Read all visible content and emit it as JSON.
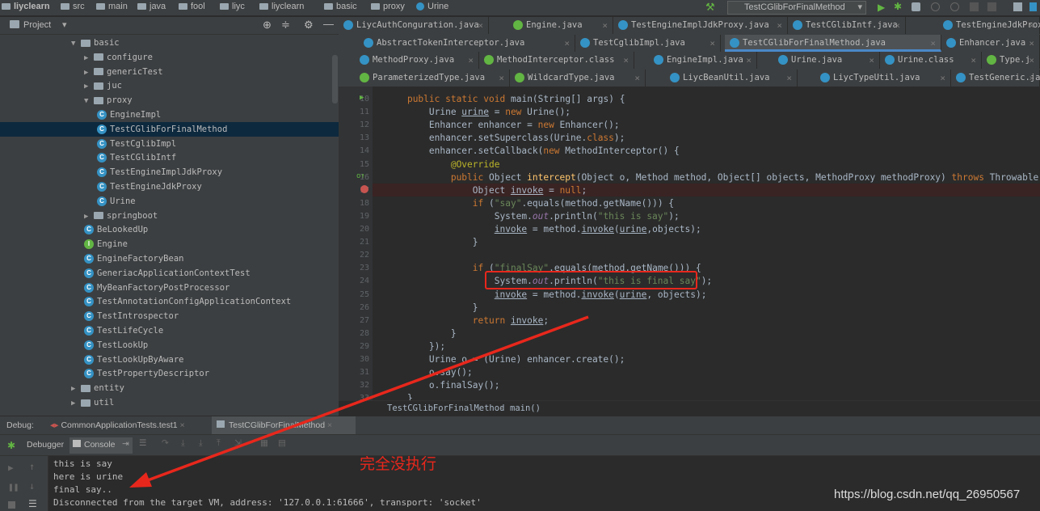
{
  "breadcrumb": [
    "liyclearn",
    "src",
    "main",
    "java",
    "fool",
    "liyc",
    "liyclearn",
    "basic",
    "proxy",
    "Urine"
  ],
  "run_config": "TestCGlibForFinalMethod",
  "project_panel": {
    "title": "Project"
  },
  "tree": [
    {
      "label": "basic",
      "kind": "folder",
      "open": true
    },
    {
      "label": "configure",
      "kind": "folder",
      "open": false
    },
    {
      "label": "genericTest",
      "kind": "folder",
      "open": false
    },
    {
      "label": "juc",
      "kind": "folder",
      "open": false
    },
    {
      "label": "proxy",
      "kind": "folder",
      "open": true
    },
    {
      "label": "EngineImpl",
      "kind": "class"
    },
    {
      "label": "TestCGlibForFinalMethod",
      "kind": "class",
      "selected": true
    },
    {
      "label": "TestCglibImpl",
      "kind": "class"
    },
    {
      "label": "TestCGlibIntf",
      "kind": "class"
    },
    {
      "label": "TestEngineImplJdkProxy",
      "kind": "class"
    },
    {
      "label": "TestEngineJdkProxy",
      "kind": "class"
    },
    {
      "label": "Urine",
      "kind": "class"
    },
    {
      "label": "springboot",
      "kind": "folder",
      "open": false
    },
    {
      "label": "BeLookedUp",
      "kind": "class"
    },
    {
      "label": "Engine",
      "kind": "interface"
    },
    {
      "label": "EngineFactoryBean",
      "kind": "class"
    },
    {
      "label": "GeneriacApplicationContextTest",
      "kind": "class"
    },
    {
      "label": "MyBeanFactoryPostProcessor",
      "kind": "class"
    },
    {
      "label": "TestAnnotationConfigApplicationContext",
      "kind": "class"
    },
    {
      "label": "TestIntrospector",
      "kind": "class"
    },
    {
      "label": "TestLifeCycle",
      "kind": "class"
    },
    {
      "label": "TestLookUp",
      "kind": "class"
    },
    {
      "label": "TestLookUpByAware",
      "kind": "class"
    },
    {
      "label": "TestPropertyDescriptor",
      "kind": "class"
    },
    {
      "label": "entity",
      "kind": "folder",
      "open": false
    },
    {
      "label": "util",
      "kind": "folder",
      "open": false
    }
  ],
  "tab_rows": [
    [
      {
        "label": "LiycAuthConguration.java",
        "icon": "class"
      },
      {
        "label": "Engine.java",
        "icon": "interface"
      },
      {
        "label": "TestEngineImplJdkProxy.java",
        "icon": "class"
      },
      {
        "label": "TestCGlibIntf.java",
        "icon": "class"
      },
      {
        "label": "TestEngineJdkProxy.j",
        "icon": "class"
      }
    ],
    [
      {
        "label": "AbstractTokenInterceptor.java",
        "icon": "class"
      },
      {
        "label": "TestCglibImpl.java",
        "icon": "class"
      },
      {
        "label": "TestCGlibForFinalMethod.java",
        "icon": "class",
        "active": true
      },
      {
        "label": "Enhancer.java",
        "icon": "class"
      }
    ],
    [
      {
        "label": "MethodProxy.java",
        "icon": "class"
      },
      {
        "label": "MethodInterceptor.class",
        "icon": "interface"
      },
      {
        "label": "EngineImpl.java",
        "icon": "class"
      },
      {
        "label": "Urine.java",
        "icon": "class"
      },
      {
        "label": "Urine.class",
        "icon": "class"
      },
      {
        "label": "Type.j",
        "icon": "interface"
      }
    ],
    [
      {
        "label": "ParameterizedType.java",
        "icon": "interface"
      },
      {
        "label": "WildcardType.java",
        "icon": "interface"
      },
      {
        "label": "LiycBeanUtil.java",
        "icon": "class"
      },
      {
        "label": "LiycTypeUtil.java",
        "icon": "class"
      },
      {
        "label": "TestGeneric.ja",
        "icon": "class"
      }
    ]
  ],
  "code_lines": [
    {
      "n": "10",
      "text": "    public static void main(String[] args) {"
    },
    {
      "n": "11",
      "text": "        Urine urine = new Urine();"
    },
    {
      "n": "12",
      "text": "        Enhancer enhancer = new Enhancer();"
    },
    {
      "n": "13",
      "text": "        enhancer.setSuperclass(Urine.class);"
    },
    {
      "n": "14",
      "text": "        enhancer.setCallback(new MethodInterceptor() {"
    },
    {
      "n": "15",
      "text": "            @Override"
    },
    {
      "n": "16",
      "text": "            public Object intercept(Object o, Method method, Object[] objects, MethodProxy methodProxy) throws Throwable {"
    },
    {
      "n": "17",
      "text": "                Object invoke = null;"
    },
    {
      "n": "18",
      "text": "                if (\"say\".equals(method.getName())) {"
    },
    {
      "n": "19",
      "text": "                    System.out.println(\"this is say\");"
    },
    {
      "n": "20",
      "text": "                    invoke = method.invoke(urine,objects);"
    },
    {
      "n": "21",
      "text": "                }"
    },
    {
      "n": "22",
      "text": ""
    },
    {
      "n": "23",
      "text": "                if (\"finalSay\".equals(method.getName())) {"
    },
    {
      "n": "24",
      "text": "                    System.out.println(\"this is final say\");"
    },
    {
      "n": "25",
      "text": "                    invoke = method.invoke(urine, objects);"
    },
    {
      "n": "26",
      "text": "                }"
    },
    {
      "n": "27",
      "text": "                return invoke;"
    },
    {
      "n": "28",
      "text": "            }"
    },
    {
      "n": "29",
      "text": "        });"
    },
    {
      "n": "30",
      "text": "        Urine o = (Urine) enhancer.create();"
    },
    {
      "n": "31",
      "text": "        o.say();"
    },
    {
      "n": "32",
      "text": "        o.finalSay();"
    },
    {
      "n": "33",
      "text": "    }"
    }
  ],
  "editor_breadcrumb": {
    "cls": "TestCGlibForFinalMethod",
    "method": "main()"
  },
  "debug": {
    "label": "Debug:",
    "tabs": [
      "CommonApplicationTests.test1",
      "TestCGlibForFinalMethod"
    ],
    "debugger_tab": "Debugger",
    "console_tab": "Console"
  },
  "console_lines": [
    "this is say",
    "here is urine",
    "final say..",
    "Disconnected from the target VM, address: '127.0.0.1:61666', transport: 'socket'"
  ],
  "annotation_text": "完全没执行",
  "watermark": "https://blog.csdn.net/qq_26950567",
  "colors": {
    "annotation_red": "#e8271c",
    "selection": "#0d293e",
    "keyword": "#cc7832",
    "string": "#6a8759"
  }
}
